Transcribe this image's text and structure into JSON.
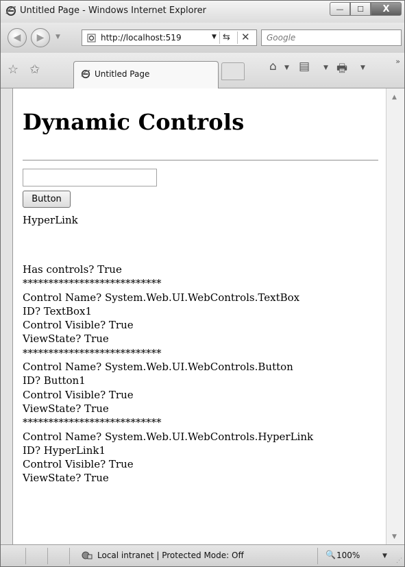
{
  "window": {
    "title": "Untitled Page - Windows Internet Explorer",
    "caption_minimize": "—",
    "caption_maximize": "☐",
    "caption_close": "X"
  },
  "nav": {
    "address": "http://localhost:519",
    "search_placeholder": "Google"
  },
  "tabs": [
    {
      "label": "Untitled Page"
    }
  ],
  "page": {
    "heading": "Dynamic Controls",
    "textbox_value": "",
    "button_label": "Button",
    "hyperlink_label": "HyperLink",
    "output_lines": [
      "Has controls? True",
      "***************************",
      "Control Name? System.Web.UI.WebControls.TextBox",
      "ID? TextBox1",
      "Control Visible? True",
      "ViewState? True",
      "***************************",
      "Control Name? System.Web.UI.WebControls.Button",
      "ID? Button1",
      "Control Visible? True",
      "ViewState? True",
      "***************************",
      "Control Name? System.Web.UI.WebControls.HyperLink",
      "ID? HyperLink1",
      "Control Visible? True",
      "ViewState? True"
    ]
  },
  "status": {
    "zone": "Local intranet | Protected Mode: Off",
    "zoom": "100%"
  },
  "icons": {
    "ie": "ie-logo-icon",
    "back": "back-icon",
    "forward": "forward-icon",
    "refresh": "refresh-icon",
    "stop": "stop-icon",
    "favorites": "star-icon",
    "add_favorites": "add-favorites-icon",
    "home": "home-icon",
    "feeds": "feeds-icon",
    "print": "print-icon",
    "zone": "intranet-icon",
    "zoom": "zoom-icon"
  },
  "colors": {
    "page_background": "#ffffff",
    "chrome": "#dedede"
  }
}
